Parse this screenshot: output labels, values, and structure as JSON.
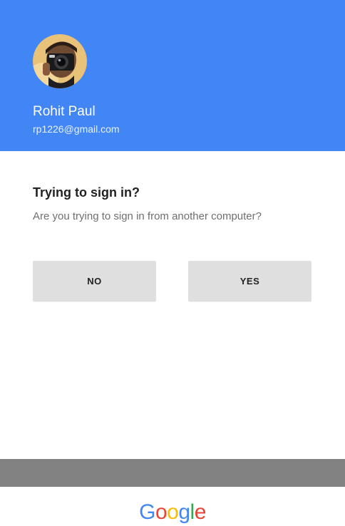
{
  "account": {
    "name": "Rohit Paul",
    "email": "rp1226@gmail.com",
    "avatar_icon": "profile-photo"
  },
  "prompt": {
    "title": "Trying to sign in?",
    "question": "Are you trying to sign in from another computer?"
  },
  "buttons": {
    "no_label": "NO",
    "yes_label": "YES"
  },
  "footer": {
    "logo_text": "Google"
  },
  "colors": {
    "header_bg": "#4285f4",
    "button_bg": "#dfdfdf",
    "footer_bar": "#828282",
    "logo_blue": "#4285f4",
    "logo_red": "#ea4335",
    "logo_yellow": "#fbbc05",
    "logo_green": "#34a853"
  }
}
